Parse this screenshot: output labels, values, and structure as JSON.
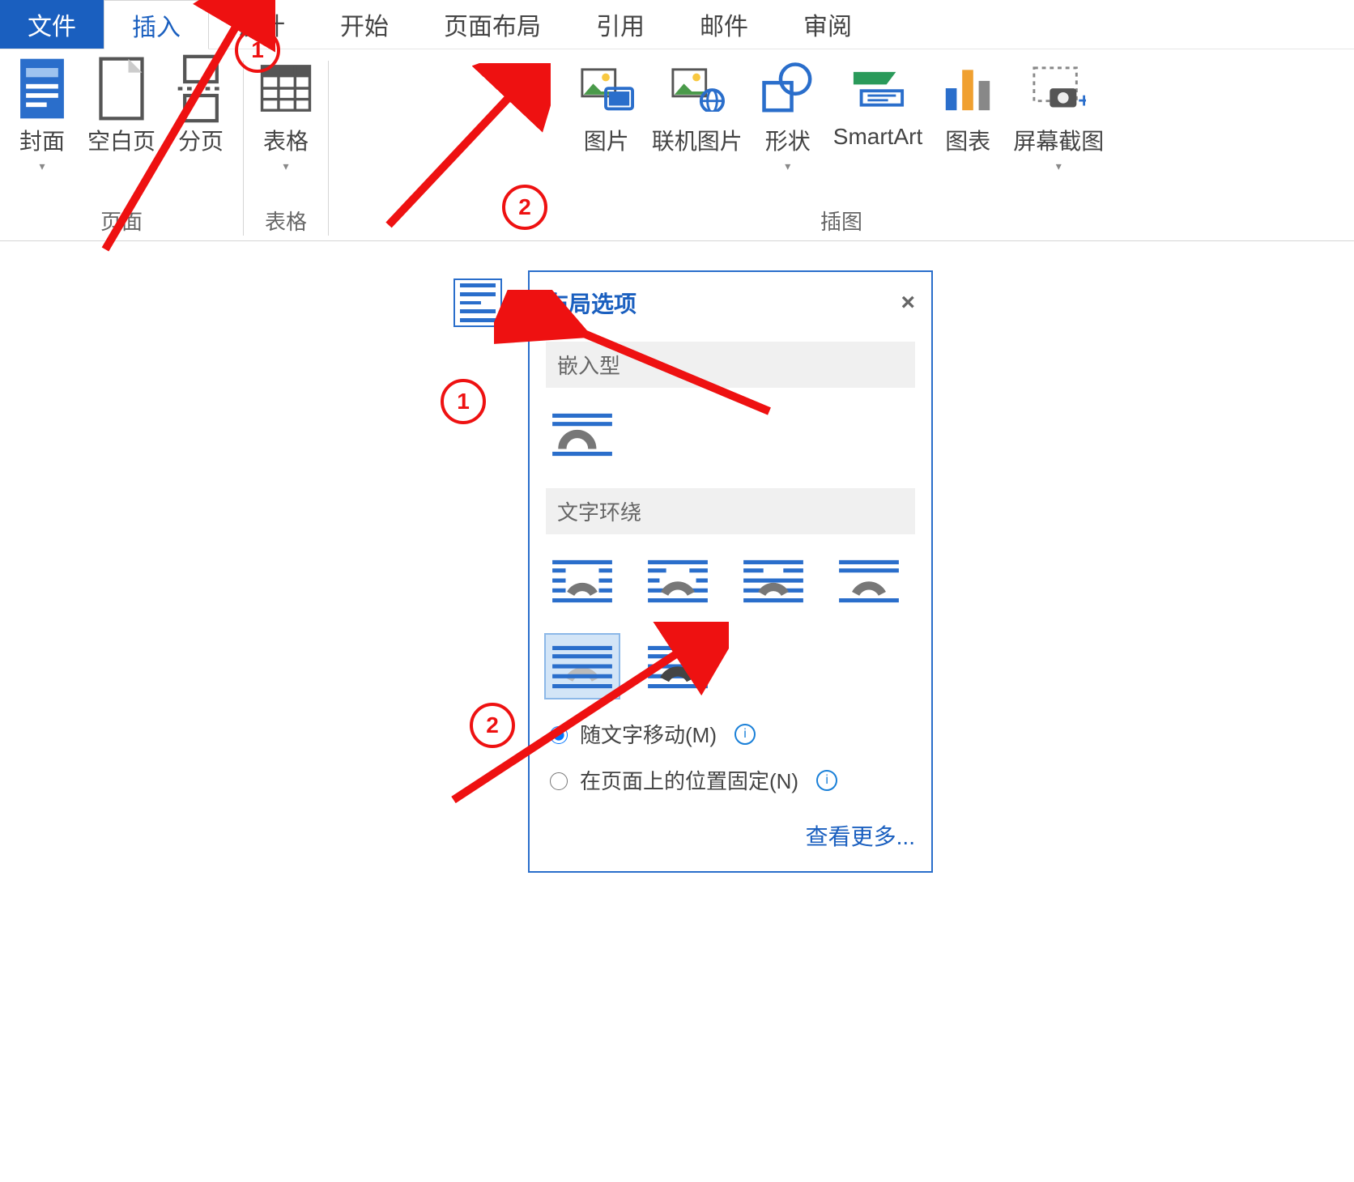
{
  "tabs": {
    "file": "文件",
    "insert": "插入",
    "design": "设计",
    "home": "开始",
    "layout": "页面布局",
    "references": "引用",
    "mailings": "邮件",
    "review": "审阅"
  },
  "ribbon": {
    "groups": {
      "pages": {
        "label": "页面",
        "cover": "封面",
        "blank": "空白页",
        "break": "分页"
      },
      "tables": {
        "label": "表格",
        "table": "表格"
      },
      "illustrations": {
        "label": "插图",
        "picture": "图片",
        "online_picture": "联机图片",
        "shapes": "形状",
        "smartart": "SmartArt",
        "chart": "图表",
        "screenshot": "屏幕截图"
      }
    }
  },
  "panel": {
    "title": "布局选项",
    "close": "×",
    "inline_label": "嵌入型",
    "wrap_label": "文字环绕",
    "radio_move": "随文字移动(M)",
    "radio_fixed": "在页面上的位置固定(N)",
    "see_more": "查看更多..."
  },
  "annotations": {
    "top1": "1",
    "top2": "2",
    "bot1": "1",
    "bot2": "2"
  }
}
